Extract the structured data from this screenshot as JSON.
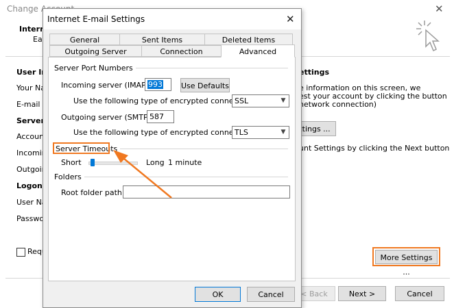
{
  "background_window": {
    "title": "Change Account",
    "header_title": "Intern",
    "header_subtitle": "Ea",
    "sections": {
      "user_info": "User In",
      "your_name": "Your Nar",
      "email": "E-mail Ac",
      "server": "Server",
      "account_type": "Account",
      "incoming": "Incoming",
      "outgoing": "Outgoing",
      "logon": "Logon I",
      "user_name": "User Nan",
      "password": "Passwor",
      "require": "Requi"
    },
    "right_panel": {
      "heading": "ettings",
      "line1": "e information on this screen, we",
      "line2": "est your account by clicking the button",
      "line3": "network connection)",
      "test_button": "ttings ...",
      "next_hint": "unt Settings by clicking the Next button"
    },
    "buttons": {
      "more_settings": "More Settings ...",
      "back": "< Back",
      "next": "Next >",
      "cancel": "Cancel"
    }
  },
  "dialog": {
    "title": "Internet E-mail Settings",
    "tabs_row1": [
      "General",
      "Sent Items",
      "Deleted Items"
    ],
    "tabs_row2": [
      "Outgoing Server",
      "Connection",
      "Advanced"
    ],
    "active_tab": "Advanced",
    "server_ports": {
      "group_title": "Server Port Numbers",
      "incoming_label": "Incoming server (IMAP):",
      "incoming_value": "993",
      "use_defaults": "Use Defaults",
      "encryption_label_in": "Use the following type of encrypted connection:",
      "encryption_in": "SSL",
      "outgoing_label": "Outgoing server (SMTP):",
      "outgoing_value": "587",
      "encryption_label_out": "Use the following type of encrypted connection:",
      "encryption_out": "TLS"
    },
    "timeouts": {
      "group_title": "Server Timeouts",
      "short": "Short",
      "long": "Long",
      "value": "1 minute",
      "slider_level": 0.04
    },
    "folders": {
      "group_title": "Folders",
      "root_label": "Root folder path:",
      "root_value": ""
    },
    "ok": "OK",
    "cancel": "Cancel"
  },
  "colors": {
    "highlight": "#f07820",
    "accent": "#0078d7"
  },
  "icons": [
    "close-icon",
    "dropdown-arrow-icon",
    "cursor-click-icon"
  ]
}
